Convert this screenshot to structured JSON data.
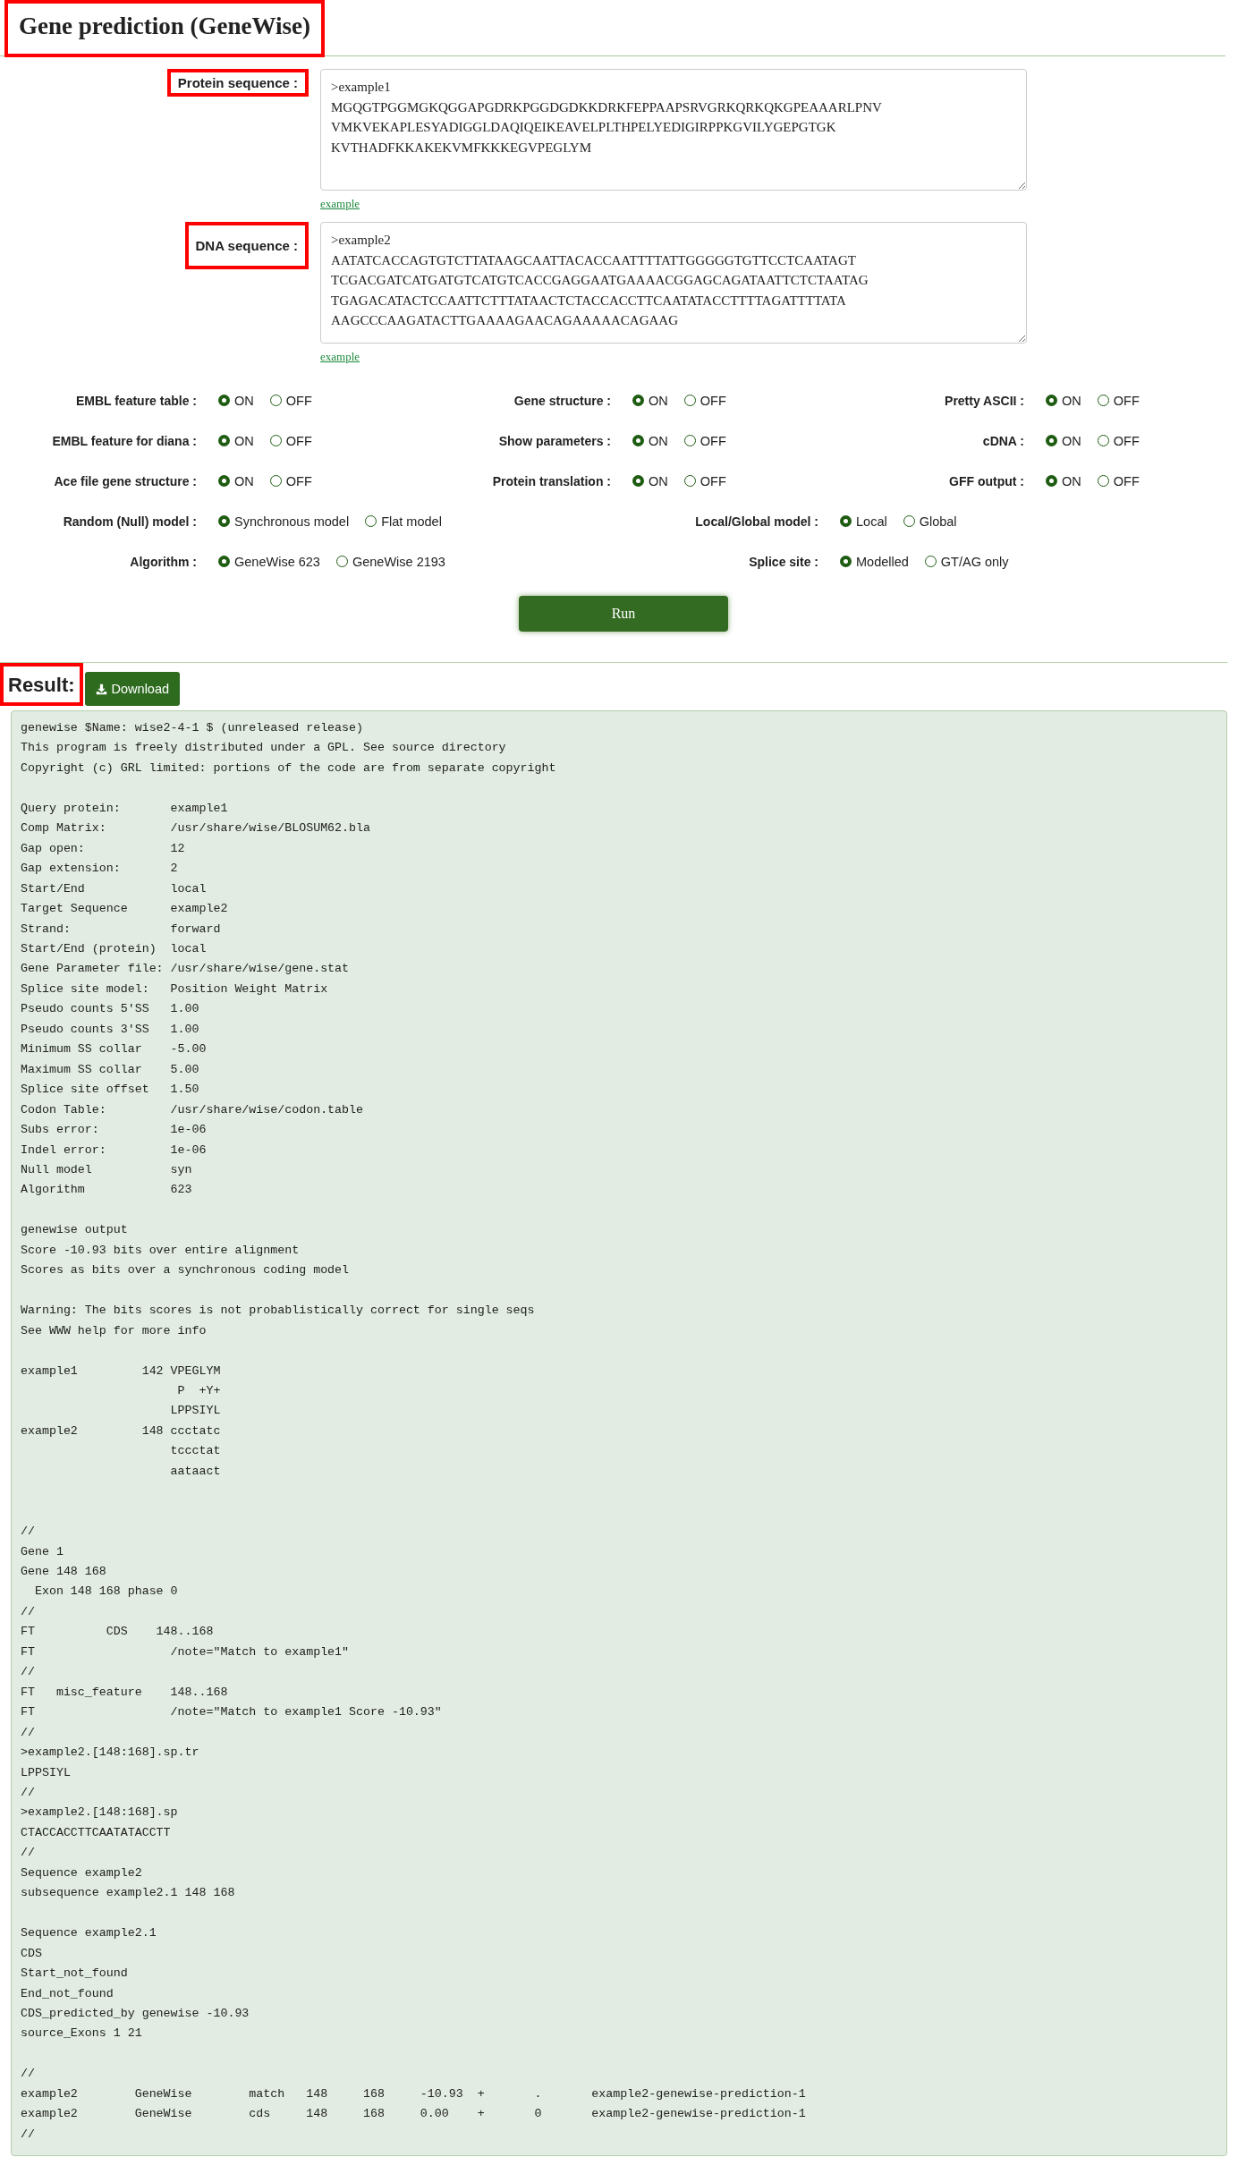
{
  "title": {
    "text": "Gene prediction (GeneWise)",
    "highlighted": true
  },
  "sequences": [
    {
      "label": "Protein sequence :",
      "highlighted": true,
      "value": ">example1\nMGQGTPGGMGKQGGAPGDRKPGGDGDKKDRKFEPPAAPSRVGRKQRKQKGPEAAARLPNV\nVMKVEKAPLESYADIGGLDAQIQEIKEAVELPLTHPELYEDIGIRPPKGVILYGEPGTGK\nKVTHADFKKAKEKVMFKKKEGVPEGLYM",
      "link": "example"
    },
    {
      "label": "DNA sequence :",
      "highlighted": true,
      "value": ">example2\nAATATCACCAGTGTCTTATAAGCAATTACACCAATTTTATTGGGGGTGTTCCTCAATAGT\nTCGACGATCATGATGTCATGTCACCGAGGAATGAAAACGGAGCAGATAATTCTCTAATAG\nTGAGACATACTCCAATTCTTTATAACTCTACCACCTTCAATATACCTTTTAGATTTTATA\nAAGCCCAAGATACTTGAAAAGAACAGAAAAACAGAAG",
      "link": "example"
    }
  ],
  "options": [
    [
      {
        "label": "EMBL feature table :",
        "choices": [
          {
            "label": "ON",
            "selected": true
          },
          {
            "label": "OFF",
            "selected": false
          }
        ]
      },
      {
        "label": "Gene structure :",
        "choices": [
          {
            "label": "ON",
            "selected": true
          },
          {
            "label": "OFF",
            "selected": false
          }
        ]
      },
      {
        "label": "Pretty ASCII :",
        "choices": [
          {
            "label": "ON",
            "selected": true
          },
          {
            "label": "OFF",
            "selected": false
          }
        ]
      }
    ],
    [
      {
        "label": "EMBL feature for diana :",
        "choices": [
          {
            "label": "ON",
            "selected": true
          },
          {
            "label": "OFF",
            "selected": false
          }
        ]
      },
      {
        "label": "Show parameters :",
        "choices": [
          {
            "label": "ON",
            "selected": true
          },
          {
            "label": "OFF",
            "selected": false
          }
        ]
      },
      {
        "label": "cDNA :",
        "choices": [
          {
            "label": "ON",
            "selected": true
          },
          {
            "label": "OFF",
            "selected": false
          }
        ]
      }
    ],
    [
      {
        "label": "Ace file gene structure :",
        "choices": [
          {
            "label": "ON",
            "selected": true
          },
          {
            "label": "OFF",
            "selected": false
          }
        ]
      },
      {
        "label": "Protein translation :",
        "choices": [
          {
            "label": "ON",
            "selected": true
          },
          {
            "label": "OFF",
            "selected": false
          }
        ]
      },
      {
        "label": "GFF output :",
        "choices": [
          {
            "label": "ON",
            "selected": true
          },
          {
            "label": "OFF",
            "selected": false
          }
        ]
      }
    ],
    [
      {
        "label": "Random (Null) model :",
        "choices": [
          {
            "label": "Synchronous model",
            "selected": true
          },
          {
            "label": "Flat model",
            "selected": false
          }
        ]
      },
      {
        "label": "Local/Global model :",
        "choices": [
          {
            "label": "Local",
            "selected": true
          },
          {
            "label": "Global",
            "selected": false
          }
        ]
      }
    ],
    [
      {
        "label": "Algorithm :",
        "choices": [
          {
            "label": "GeneWise 623",
            "selected": true
          },
          {
            "label": "GeneWise 2193",
            "selected": false
          }
        ]
      },
      {
        "label": "Splice site :",
        "choices": [
          {
            "label": "Modelled",
            "selected": true
          },
          {
            "label": "GT/AG only",
            "selected": false
          }
        ]
      }
    ]
  ],
  "run_button": "Run",
  "result": {
    "heading": "Result:",
    "highlighted": true,
    "download_button": "Download",
    "output": "genewise $Name: wise2-4-1 $ (unreleased release)\nThis program is freely distributed under a GPL. See source directory\nCopyright (c) GRL limited: portions of the code are from separate copyright\n\nQuery protein:       example1\nComp Matrix:         /usr/share/wise/BLOSUM62.bla\nGap open:            12\nGap extension:       2\nStart/End            local\nTarget Sequence      example2\nStrand:              forward\nStart/End (protein)  local\nGene Parameter file: /usr/share/wise/gene.stat\nSplice site model:   Position Weight Matrix\nPseudo counts 5'SS   1.00\nPseudo counts 3'SS   1.00\nMinimum SS collar    -5.00\nMaximum SS collar    5.00\nSplice site offset   1.50\nCodon Table:         /usr/share/wise/codon.table\nSubs error:          1e-06\nIndel error:         1e-06\nNull model           syn\nAlgorithm            623\n\ngenewise output\nScore -10.93 bits over entire alignment\nScores as bits over a synchronous coding model\n\nWarning: The bits scores is not probablistically correct for single seqs\nSee WWW help for more info\n\nexample1         142 VPEGLYM\n                      P  +Y+\n                     LPPSIYL\nexample2         148 ccctatc\n                     tccctat\n                     aataact\n\n\n//\nGene 1\nGene 148 168\n  Exon 148 168 phase 0\n//\nFT          CDS    148..168\nFT                   /note=\"Match to example1\"\n//\nFT   misc_feature    148..168\nFT                   /note=\"Match to example1 Score -10.93\"\n//\n>example2.[148:168].sp.tr\nLPPSIYL\n//\n>example2.[148:168].sp\nCTACCACCTTCAATATACCTT\n//\nSequence example2\nsubsequence example2.1 148 168\n\nSequence example2.1\nCDS\nStart_not_found\nEnd_not_found\nCDS_predicted_by genewise -10.93\nsource_Exons 1 21\n\n//\nexample2\tGeneWise\tmatch\t148\t168\t-10.93\t+\t.\texample2-genewise-prediction-1\nexample2\tGeneWise\tcds\t148\t168\t0.00\t+\t0\texample2-genewise-prediction-1\n//"
  }
}
